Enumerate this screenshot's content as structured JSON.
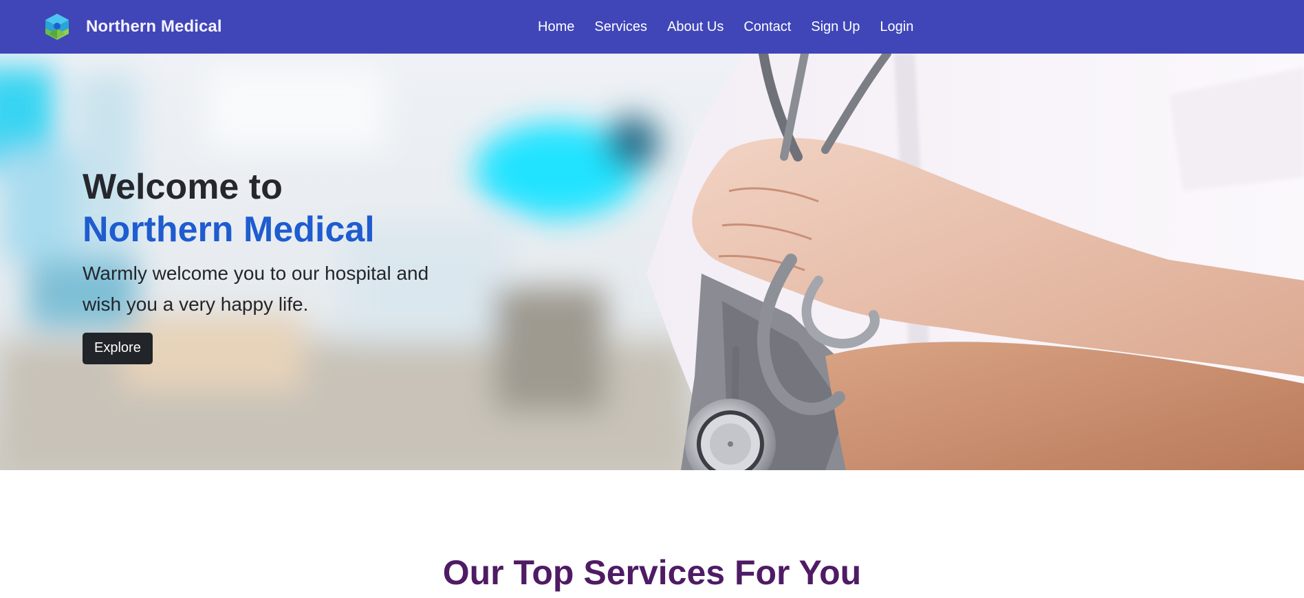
{
  "brand": {
    "name": "Northern Medical",
    "logo_icon": "hexagon-plant-logo-icon"
  },
  "nav": {
    "items": [
      {
        "label": "Home"
      },
      {
        "label": "Services"
      },
      {
        "label": "About Us"
      },
      {
        "label": "Contact"
      },
      {
        "label": "Sign Up"
      },
      {
        "label": "Login"
      }
    ]
  },
  "hero": {
    "title_line1": "Welcome to",
    "title_line2": "Northern Medical",
    "subtitle": "Warmly welcome you to our hospital and wish you a very happy life.",
    "button_label": "Explore",
    "image": "doctor-with-stethoscope-photo"
  },
  "services": {
    "title": "Our Top Services For You"
  },
  "colors": {
    "navbar": "#4046b8",
    "accent_blue": "#1e5ccf",
    "heading_purple": "#4f1b64",
    "button_dark": "#212428"
  }
}
